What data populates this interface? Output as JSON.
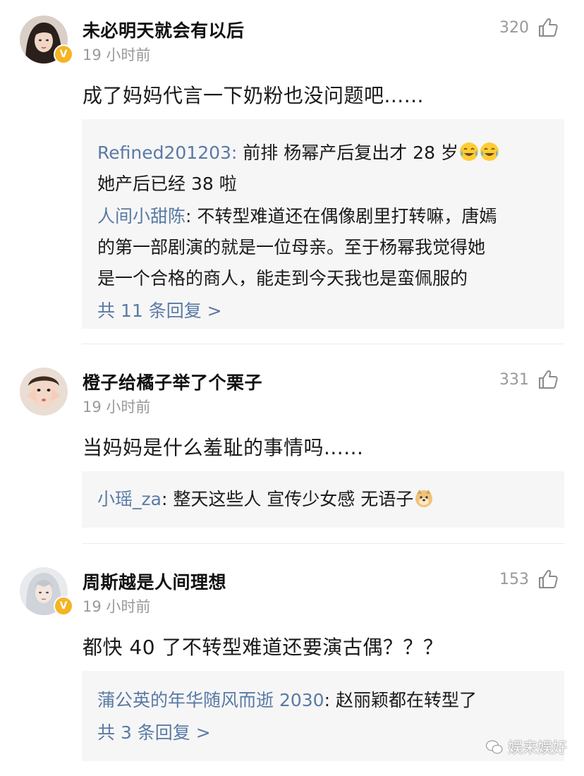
{
  "comments": [
    {
      "username": "未必明天就会有以后",
      "time": "19 小时前",
      "likes": "320",
      "text": "成了妈妈代言一下奶粉也没问题吧......",
      "replies": [
        {
          "user": "Refined201203",
          "sep": ": ",
          "text": "前排 杨幂产后复出才 28 岁",
          "text2": "她产后已经 38 啦",
          "emoji": "laugh-cry-emoji"
        },
        {
          "user": "人间小甜陈",
          "sep": ": ",
          "text": "不转型难道还在偶像剧里打转嘛，唐嫣",
          "text2": "的第一部剧演的就是一位母亲。至于杨幂我觉得她",
          "text3": "是一个合格的商人，能走到今天我也是蛮佩服的"
        }
      ],
      "more": "共 11 条回复 >"
    },
    {
      "username": "橙子给橘子举了个栗子",
      "time": "19 小时前",
      "likes": "331",
      "text": "当妈妈是什么羞耻的事情吗......",
      "replies": [
        {
          "user": "小瑶_za",
          "sep": ": ",
          "text": "整天这些人 宣传少女感  无语子",
          "emoji": "doge-emoji"
        }
      ]
    },
    {
      "username": "周斯越是人间理想",
      "time": "19 小时前",
      "likes": "153",
      "text": "都快 40 了不转型难道还要演古偶？？？",
      "replies": [
        {
          "user": "蒲公英的年华随风而逝 2030",
          "sep": ": ",
          "text": "赵丽颖都在转型了"
        }
      ],
      "more": "共 3 条回复 >"
    }
  ],
  "watermark": "娱来娱好",
  "colors": {
    "link": "#5a7aa5",
    "badge": "#f5b423",
    "reply_bg": "#f6f6f6"
  }
}
